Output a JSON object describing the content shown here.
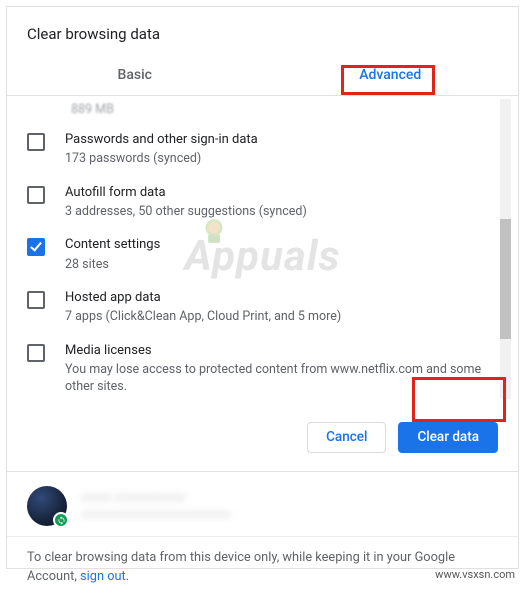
{
  "dialog": {
    "title": "Clear browsing data",
    "tabs": {
      "basic": "Basic",
      "advanced": "Advanced"
    },
    "truncated_line": "889 MB",
    "items": [
      {
        "checked": false,
        "title": "Passwords and other sign-in data",
        "sub": "173 passwords (synced)"
      },
      {
        "checked": false,
        "title": "Autofill form data",
        "sub": "3 addresses, 50 other suggestions (synced)"
      },
      {
        "checked": true,
        "title": "Content settings",
        "sub": "28 sites"
      },
      {
        "checked": false,
        "title": "Hosted app data",
        "sub": "7 apps (Click&Clean App, Cloud Print, and 5 more)"
      },
      {
        "checked": false,
        "title": "Media licenses",
        "sub": "You may lose access to protected content from www.netflix.com and some other sites."
      }
    ],
    "buttons": {
      "cancel": "Cancel",
      "clear": "Clear data"
    }
  },
  "account": {
    "name_obscured": "———  ———————",
    "email_obscured": "————————————————"
  },
  "footer": {
    "text_before": "To clear browsing data from this device only, while keeping it in your Google Account, ",
    "link": "sign out",
    "text_after": "."
  },
  "watermark": "Appuals",
  "source": "www.vsxsn.com",
  "colors": {
    "accent": "#1a73e8",
    "highlight": "#e2231a"
  }
}
